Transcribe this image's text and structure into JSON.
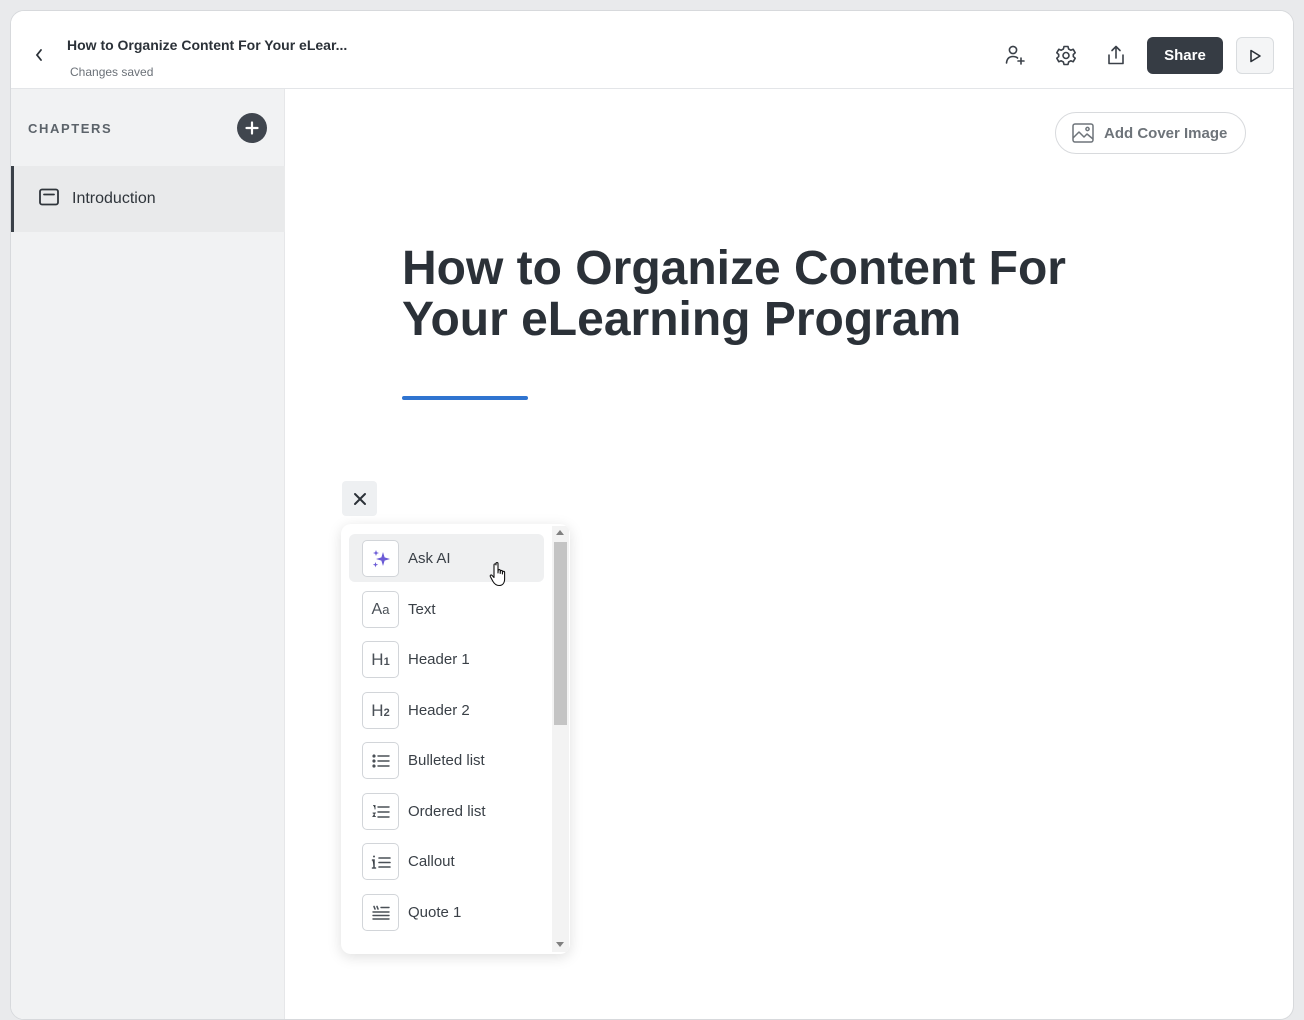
{
  "header": {
    "title": "How to Organize Content For Your eLear...",
    "status": "Changes saved",
    "share_label": "Share",
    "icons": [
      "back-chevron-icon",
      "add-user-icon",
      "settings-gear-icon",
      "export-upload-icon",
      "play-icon"
    ]
  },
  "sidebar": {
    "heading": "CHAPTERS",
    "items": [
      {
        "label": "Introduction",
        "icon": "chapter-card-icon",
        "active": true
      }
    ]
  },
  "main": {
    "cover_button_label": "Add Cover Image",
    "title": "How to Organize Content For Your eLearning Program"
  },
  "block_menu": {
    "items": [
      {
        "label": "Ask AI",
        "icon": "sparkle-ai-icon",
        "active": true
      },
      {
        "label": "Text",
        "icon": "text-aa-icon"
      },
      {
        "label": "Header 1",
        "icon": "header-1-icon"
      },
      {
        "label": "Header 2",
        "icon": "header-2-icon"
      },
      {
        "label": "Bulleted list",
        "icon": "bulleted-list-icon"
      },
      {
        "label": "Ordered list",
        "icon": "ordered-list-icon"
      },
      {
        "label": "Callout",
        "icon": "callout-icon"
      },
      {
        "label": "Quote 1",
        "icon": "quote-icon"
      }
    ]
  },
  "colors": {
    "accent": "#2f74d0",
    "ai_sparkle": "#6b5bd6",
    "dark_button": "#363c44"
  }
}
